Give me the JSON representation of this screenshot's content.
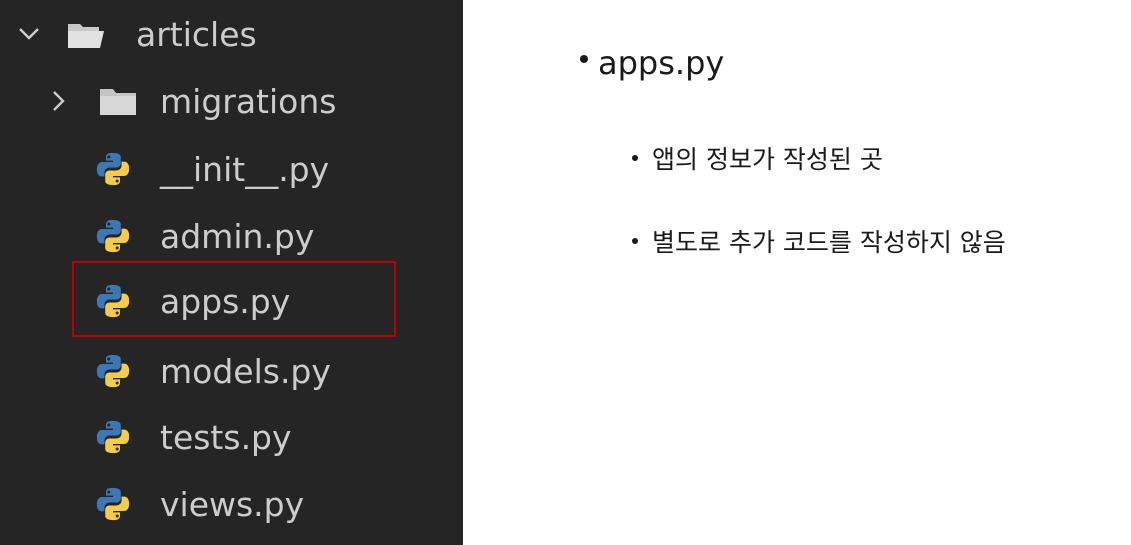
{
  "explorer": {
    "folder": {
      "name": "articles",
      "expanded": true
    },
    "subfolder": {
      "name": "migrations",
      "expanded": false
    },
    "files": [
      {
        "name": "__init__.py",
        "icon": "python-icon"
      },
      {
        "name": "admin.py",
        "icon": "python-icon"
      },
      {
        "name": "apps.py",
        "icon": "python-icon",
        "highlighted": true
      },
      {
        "name": "models.py",
        "icon": "python-icon"
      },
      {
        "name": "tests.py",
        "icon": "python-icon"
      },
      {
        "name": "views.py",
        "icon": "python-icon"
      }
    ],
    "highlight_color": "#c00000",
    "background": "#252526"
  },
  "notes": {
    "title": "apps.py",
    "items": [
      "앱의 정보가 작성된 곳",
      "별도로 추가 코드를 작성하지 않음"
    ]
  }
}
